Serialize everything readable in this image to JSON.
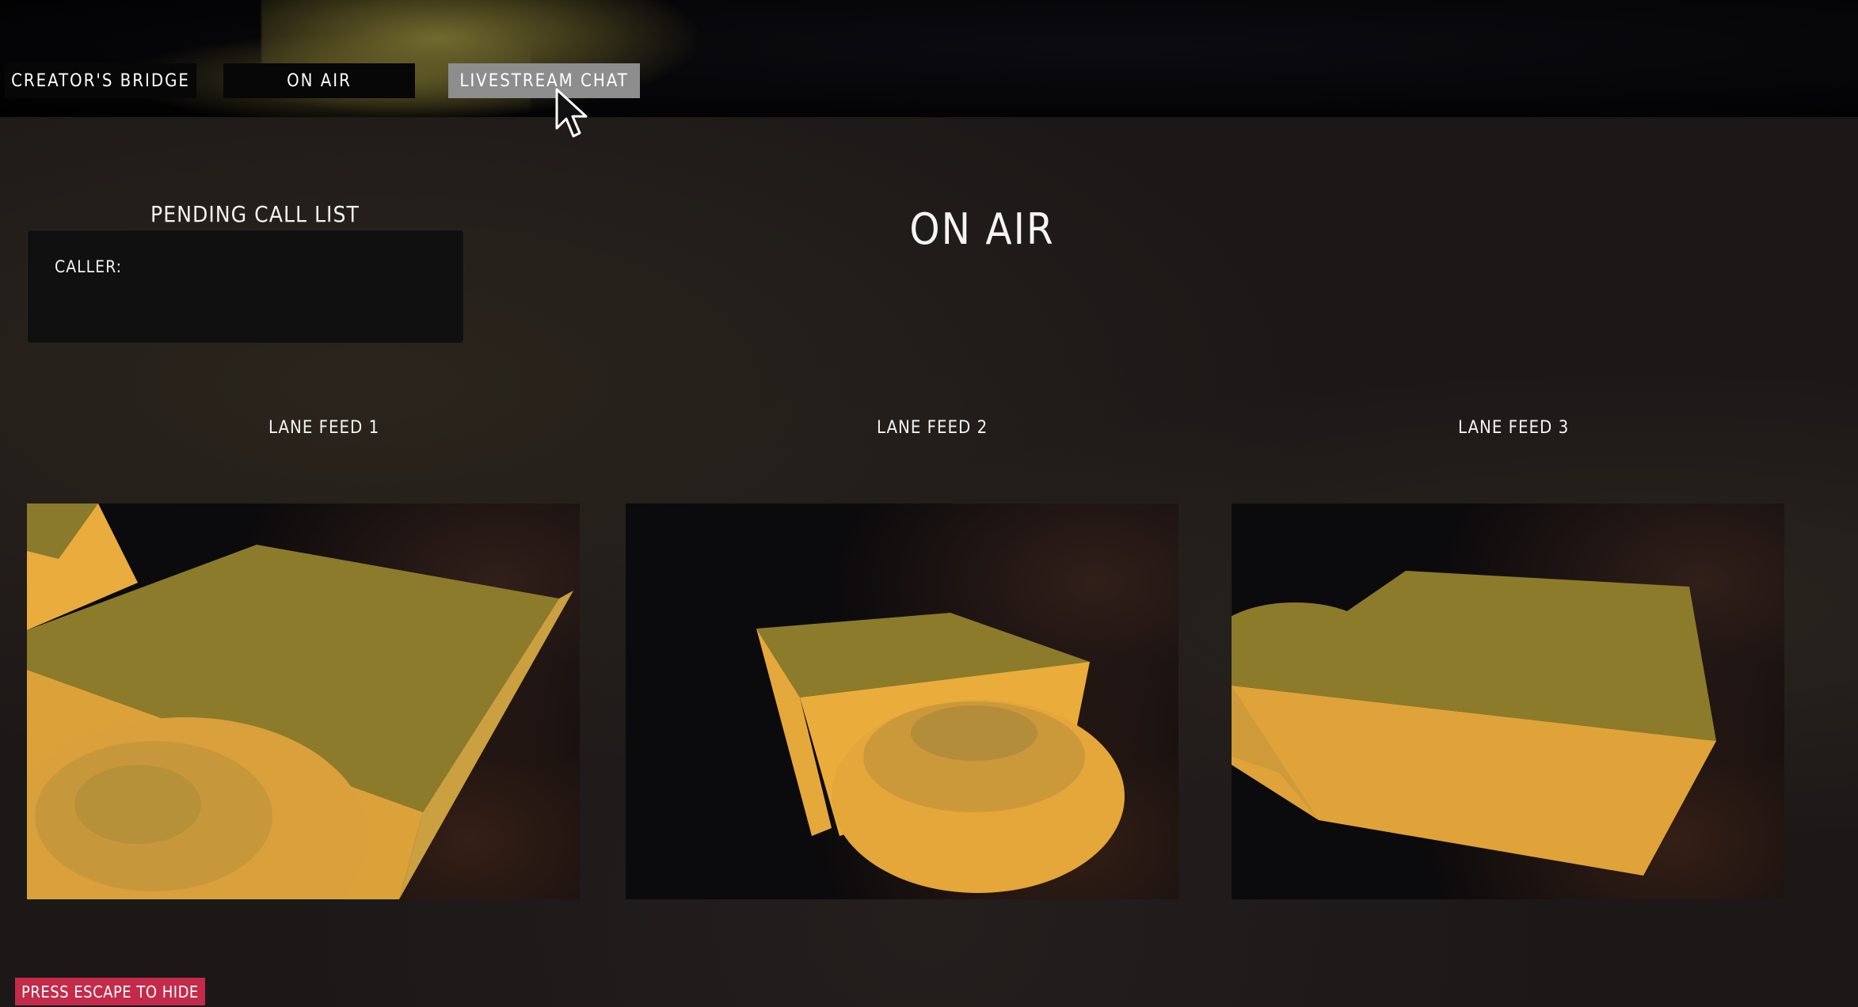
{
  "tabs": [
    {
      "label": "CREATOR'S BRIDGE",
      "active": false
    },
    {
      "label": "ON AIR",
      "active": false
    },
    {
      "label": "LIVESTREAM CHAT",
      "active": true
    }
  ],
  "pending": {
    "title": "PENDING CALL LIST",
    "caller_label": "CALLER:",
    "caller_value": ""
  },
  "main": {
    "title": "ON AIR"
  },
  "feeds": [
    {
      "label": "LANE FEED 1"
    },
    {
      "label": "LANE FEED 2"
    },
    {
      "label": "LANE FEED 3"
    }
  ],
  "footer": {
    "escape_hint": "PRESS ESCAPE TO HIDE"
  },
  "colors": {
    "active_tab": "#8d8d8d",
    "tab_bg": "#070707",
    "escape_badge": "#c42a4a",
    "object_top": "#8c7a2a",
    "object_side": "#e6a83a"
  },
  "icons": {
    "cursor": "pointer-cursor-icon"
  }
}
